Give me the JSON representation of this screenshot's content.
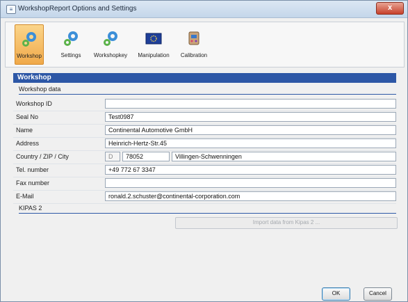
{
  "window": {
    "title": "WorkshopReport Options and Settings",
    "close_label": "x"
  },
  "toolbar": {
    "items": [
      {
        "label": "Workshop",
        "icon": "gear-icon",
        "active": true
      },
      {
        "label": "Settings",
        "icon": "gear-icon"
      },
      {
        "label": "Workshopkey",
        "icon": "gear-icon"
      },
      {
        "label": "Manipulation",
        "icon": "eu-flag-icon"
      },
      {
        "label": "Calibration",
        "icon": "calibration-icon"
      }
    ]
  },
  "section": {
    "title": "Workshop"
  },
  "workshop_data": {
    "title": "Workshop data",
    "rows": [
      {
        "label": "Workshop ID",
        "value": ""
      },
      {
        "label": "Seal No",
        "value": "Test0987"
      },
      {
        "label": "Name",
        "value": "Continental Automotive GmbH"
      },
      {
        "label": "Address",
        "value": "Heinrich-Hertz-Str.45"
      },
      {
        "label": "Country / ZIP / City",
        "country": "D",
        "zip": "78052",
        "city": "Villingen-Schwenningen"
      },
      {
        "label": "Tel. number",
        "value": "+49 772 67 3347"
      },
      {
        "label": "Fax number",
        "value": ""
      },
      {
        "label": "E-Mail",
        "value": "ronald.2.schuster@continental-corporation.com"
      }
    ]
  },
  "kipas": {
    "title": "KIPAS 2",
    "import_label": "Import data from Kipas 2 ..."
  },
  "buttons": {
    "ok": "OK",
    "cancel": "Cancel"
  },
  "colors": {
    "section_bar": "#2d57a6",
    "active_tool": "#f0a94a"
  }
}
